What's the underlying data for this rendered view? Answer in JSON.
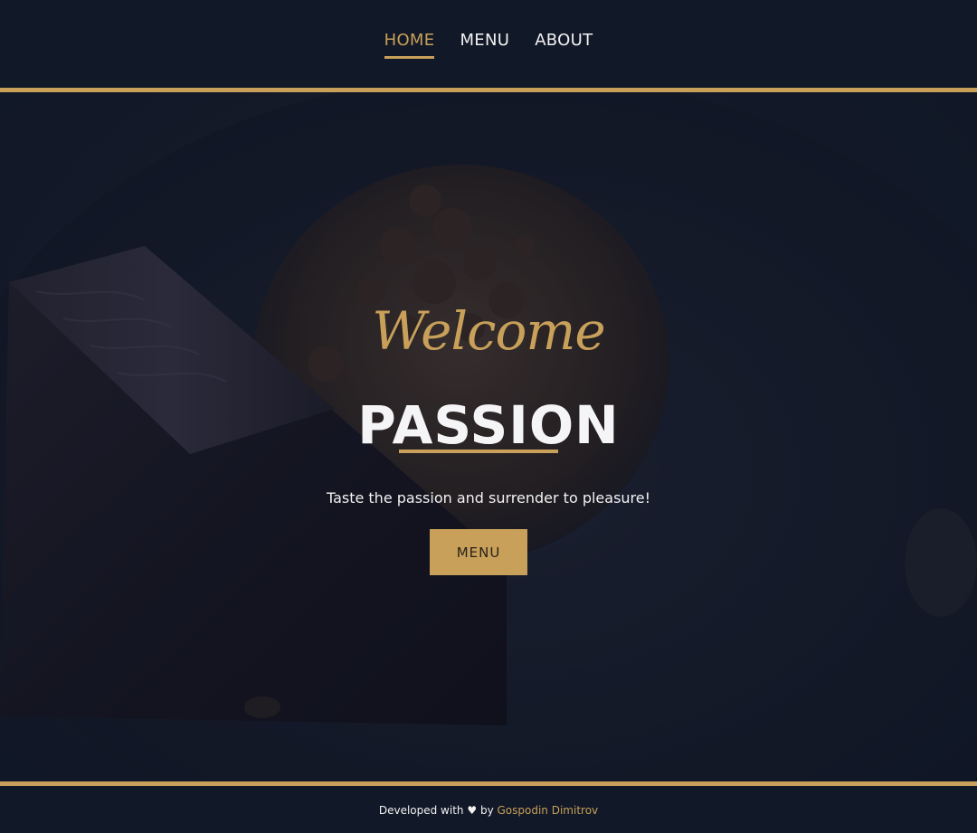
{
  "nav": {
    "items": [
      {
        "label": "HOME",
        "active": true
      },
      {
        "label": "MENU",
        "active": false
      },
      {
        "label": "ABOUT",
        "active": false
      }
    ]
  },
  "hero": {
    "welcome": "Welcome",
    "title": "PASSION",
    "tagline": "Taste the passion and surrender to pleasure!",
    "button_label": "MENU",
    "image_subject": "chocolate dessert with crumble on dark plate"
  },
  "footer": {
    "prefix": "Developed with",
    "heart_icon": "♥",
    "by": "by",
    "author": "Gospodin Dimitrov"
  },
  "colors": {
    "background": "#111827",
    "accent": "#c8a05a",
    "text": "#f5f5f7"
  }
}
